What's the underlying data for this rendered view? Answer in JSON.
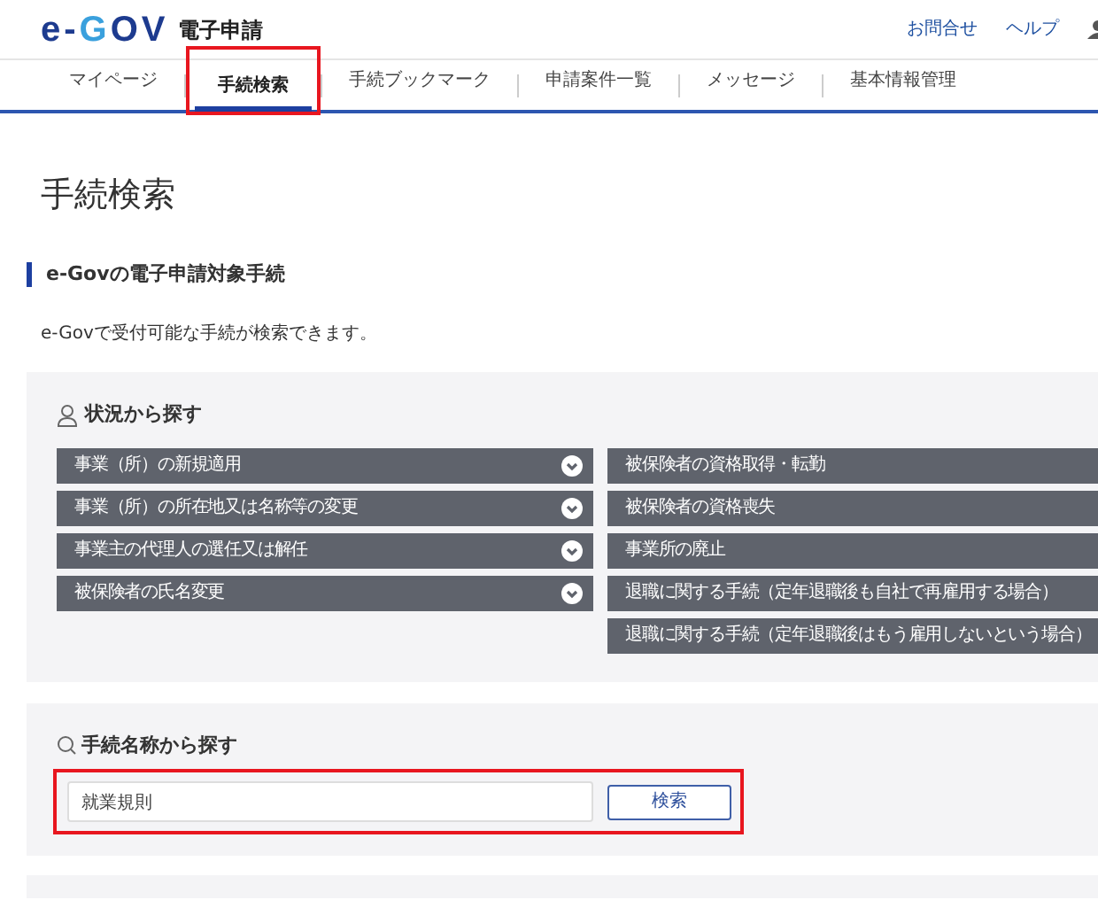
{
  "header": {
    "logo": "e-GOV",
    "service": "電子申請",
    "links": [
      "お問合せ",
      "ヘルプ"
    ]
  },
  "tabs": [
    {
      "label": "マイページ",
      "selected": false,
      "highlighted": false
    },
    {
      "label": "手続検索",
      "selected": true,
      "highlighted": true
    },
    {
      "label": "手続ブックマーク",
      "selected": false,
      "highlighted": false
    },
    {
      "label": "申請案件一覧",
      "selected": false,
      "highlighted": false
    },
    {
      "label": "メッセージ",
      "selected": false,
      "highlighted": false
    },
    {
      "label": "基本情報管理",
      "selected": false,
      "highlighted": false
    }
  ],
  "page_title": "手続検索",
  "section_title": "e-Govの電子申請対象手続",
  "description": "e-Govで受付可能な手続が検索できます。",
  "situation_panel": {
    "title": "状況から探す",
    "left_items": [
      {
        "label": "事業（所）の新規適用",
        "expandable": true
      },
      {
        "label": "事業（所）の所在地又は名称等の変更",
        "expandable": true
      },
      {
        "label": "事業主の代理人の選任又は解任",
        "expandable": true
      },
      {
        "label": "被保険者の氏名変更",
        "expandable": true
      }
    ],
    "right_items": [
      {
        "label": "被保険者の資格取得・転勤"
      },
      {
        "label": "被保険者の資格喪失"
      },
      {
        "label": "事業所の廃止"
      },
      {
        "label": "退職に関する手続（定年退職後も自社で再雇用する場合）"
      },
      {
        "label": "退職に関する手続（定年退職後はもう雇用しないという場合）"
      }
    ]
  },
  "name_search": {
    "title": "手続名称から探す",
    "value": "就業規則",
    "button": "検索",
    "highlighted": true
  }
}
